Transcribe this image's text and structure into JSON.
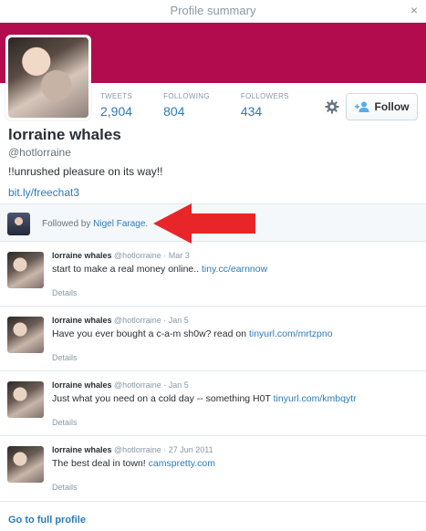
{
  "window": {
    "title": "Profile summary",
    "close_glyph": "×"
  },
  "profile": {
    "name": "lorraine whales",
    "handle": "@hotlorraine",
    "bio": "!!unrushed pleasure on its way!!",
    "link": "bit.ly/freechat3",
    "banner_color": "#b30c4e",
    "stats": [
      {
        "label": "TWEETS",
        "value": "2,904"
      },
      {
        "label": "FOLLOWING",
        "value": "804"
      },
      {
        "label": "FOLLOWERS",
        "value": "434"
      }
    ],
    "follow_label": "Follow"
  },
  "followed_by": {
    "prefix": "Followed by ",
    "name": "Nigel Farage",
    "suffix": "."
  },
  "tweets": [
    {
      "name": "lorraine whales",
      "handle": "@hotlorraine",
      "date": "· Mar 3",
      "text": "start to make a real money online.. ",
      "link": "tiny.cc/earnnow",
      "details": "Details"
    },
    {
      "name": "lorraine whales",
      "handle": "@hotlorraine",
      "date": "· Jan 5",
      "text": "Have you ever bought a c-a-m sh0w? read on ",
      "link": "tinyurl.com/mrtzpno",
      "details": "Details"
    },
    {
      "name": "lorraine whales",
      "handle": "@hotlorraine",
      "date": "· Jan 5",
      "text": "Just what you need on a cold day -- something H0T ",
      "link": "tinyurl.com/kmbqytr",
      "details": "Details"
    },
    {
      "name": "lorraine whales",
      "handle": "@hotlorraine",
      "date": "· 27 Jun 2011",
      "text": "The best deal in town! ",
      "link": "camspretty.com",
      "details": "Details"
    }
  ],
  "footer": {
    "full_profile": "Go to full profile"
  },
  "colors": {
    "link": "#2b7bb9",
    "annotation_arrow": "#e8262a"
  }
}
